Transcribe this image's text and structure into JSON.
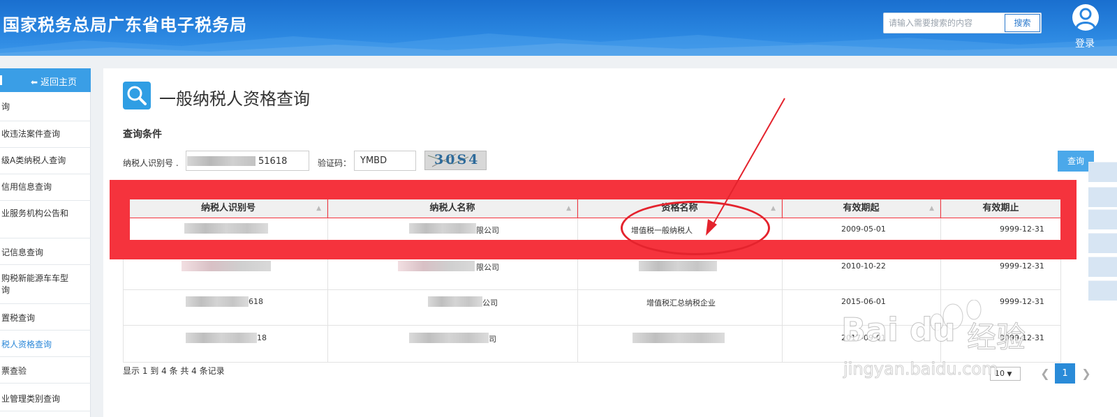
{
  "header": {
    "site_title": "国家税务总局广东省电子税务局",
    "search_placeholder": "请输入需要搜索的内容",
    "search_button": "搜索",
    "login_label": "登录"
  },
  "sidebar": {
    "back_label": "返回主页",
    "items": [
      {
        "label": "询"
      },
      {
        "label": "收违法案件查询"
      },
      {
        "label": "级A类纳税人查询"
      },
      {
        "label": "信用信息查询"
      },
      {
        "label": "业服务机构公告和"
      },
      {
        "label": "记信息查询"
      },
      {
        "label": "购税新能源车车型\n询"
      },
      {
        "label": "置税查询"
      },
      {
        "label": "税人资格查询"
      },
      {
        "label": "票查验"
      },
      {
        "label": "业管理类别查询"
      }
    ]
  },
  "page": {
    "title": "一般纳税人资格查询",
    "section_label": "查询条件",
    "taxid_label": "纳税人识别号",
    "taxid_value_visible": "51618",
    "captcha_label": "验证码：",
    "captcha_value": "YMBD",
    "captcha_image_text": "30S4",
    "query_button": "查询"
  },
  "table": {
    "columns": [
      "纳税人识别号",
      "纳税人名称",
      "资格名称",
      "有效期起",
      "有效期止"
    ],
    "rows": [
      {
        "taxid": "",
        "name": "限公司",
        "qualification": "增值税一般纳税人",
        "start": "2009-05-01",
        "end": "9999-12-31"
      },
      {
        "taxid": "",
        "name": "限公司",
        "qualification": "",
        "start": "2010-10-22",
        "end": "9999-12-31"
      },
      {
        "taxid": "618",
        "name": "公司",
        "qualification": "增值税汇总纳税企业",
        "start": "2015-06-01",
        "end": "9999-12-31"
      },
      {
        "taxid": "18",
        "name": "司",
        "qualification": "",
        "start": "2017-09-01",
        "end": "9999-12-31"
      }
    ]
  },
  "footer": {
    "record_info": "显示 1 到 4 条 共 4 条记录",
    "page_size": "10",
    "current_page": "1"
  },
  "watermark": {
    "brand": "Bai du",
    "cn": "经验",
    "url": "jingyan.baidu.com"
  },
  "colors": {
    "header_blue": "#2a86e0",
    "accent_blue": "#3a9ee6",
    "annotation_red": "#f5333d"
  }
}
